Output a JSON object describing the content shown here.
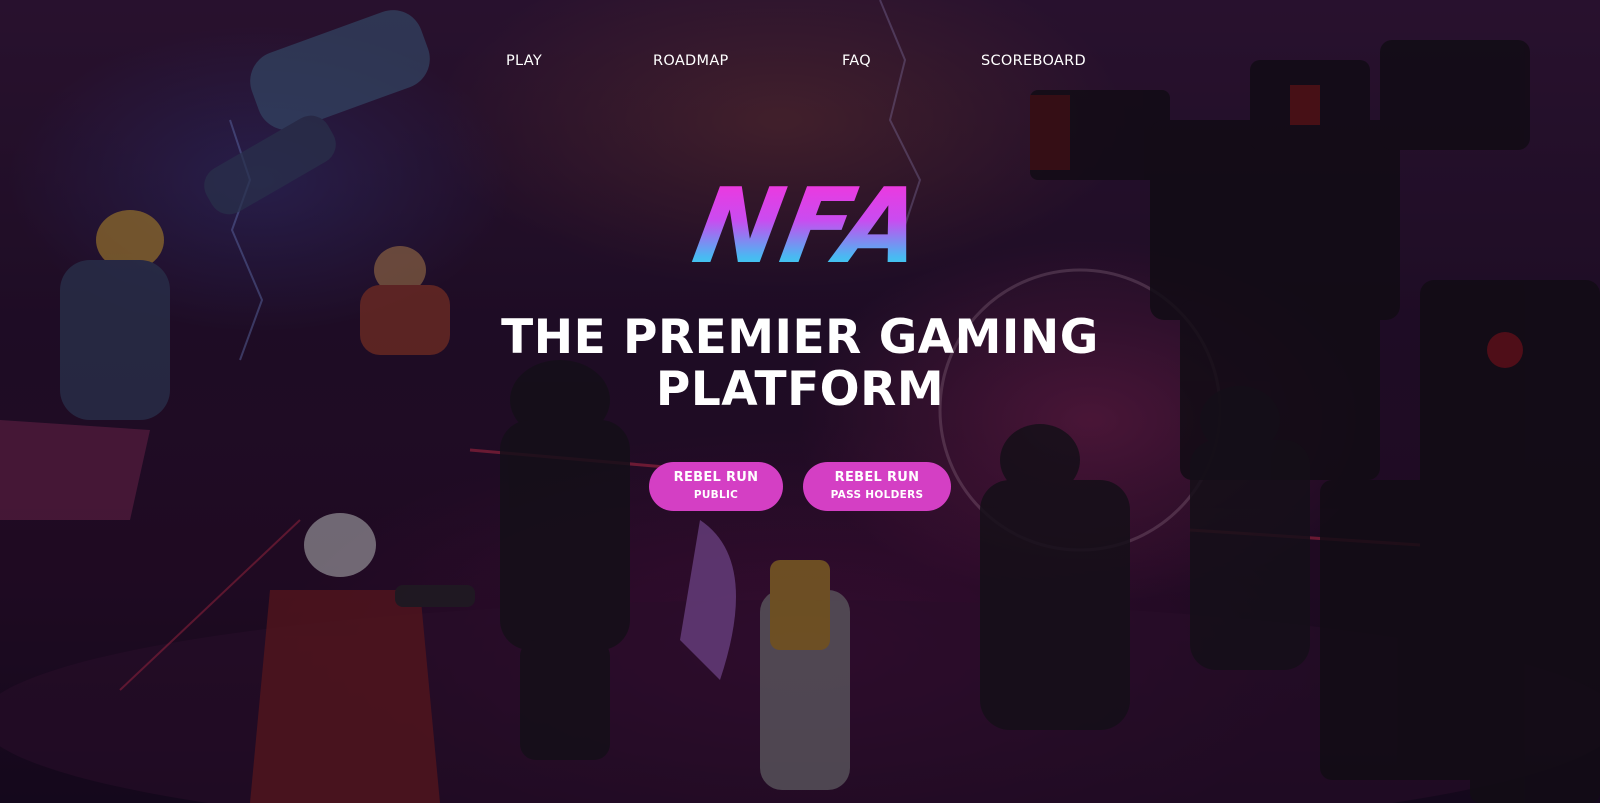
{
  "nav": {
    "items": [
      {
        "label": "PLAY"
      },
      {
        "label": "ROADMAP"
      },
      {
        "label": "FAQ"
      },
      {
        "label": "SCOREBOARD"
      }
    ]
  },
  "logo": {
    "text": "NFA"
  },
  "hero": {
    "headline_line1": "THE PREMIER GAMING",
    "headline_line2": "PLATFORM"
  },
  "buttons": [
    {
      "line1": "REBEL RUN",
      "line2": "PUBLIC"
    },
    {
      "line1": "REBEL RUN",
      "line2": "PASS HOLDERS"
    }
  ],
  "colors": {
    "button_bg": "#d43fc4",
    "logo_gradient_top": "#ff2fd6",
    "logo_gradient_bottom": "#25f0e0",
    "text": "#ffffff"
  }
}
